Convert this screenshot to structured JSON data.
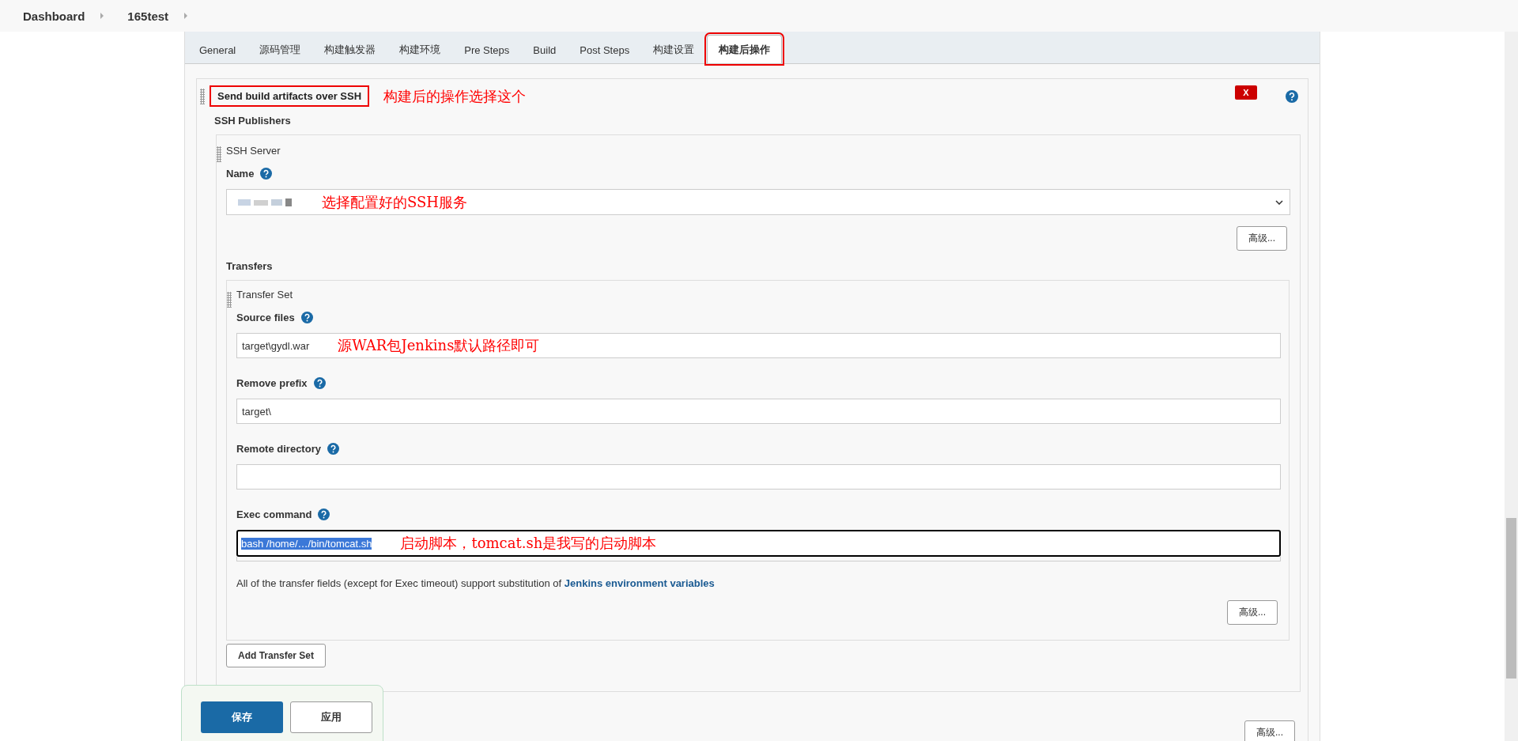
{
  "breadcrumbs": [
    {
      "label": "Dashboard"
    },
    {
      "label": "165test"
    }
  ],
  "tabs": [
    {
      "label": "General",
      "selected": false,
      "highlighted": false
    },
    {
      "label": "源码管理",
      "selected": false,
      "highlighted": false
    },
    {
      "label": "构建触发器",
      "selected": false,
      "highlighted": false
    },
    {
      "label": "构建环境",
      "selected": false,
      "highlighted": false
    },
    {
      "label": "Pre Steps",
      "selected": false,
      "highlighted": false
    },
    {
      "label": "Build",
      "selected": false,
      "highlighted": false
    },
    {
      "label": "Post Steps",
      "selected": false,
      "highlighted": false
    },
    {
      "label": "构建设置",
      "selected": false,
      "highlighted": false
    },
    {
      "label": "构建后操作",
      "selected": true,
      "highlighted": true
    }
  ],
  "section": {
    "title": "Send build artifacts over SSH",
    "highlighted": true,
    "annotation": "构建后的操作选择这个",
    "delete_label": "X",
    "publishers_label": "SSH Publishers",
    "server": {
      "title": "SSH Server",
      "name_label": "Name",
      "name_redacted": true,
      "name_annotation": "选择配置好的SSH服务",
      "advanced_label": "高级...",
      "transfers_label": "Transfers",
      "transfer_set": {
        "title": "Transfer Set",
        "fields": [
          {
            "label": "Source files",
            "value": "target\\gydl.war",
            "annotation": "源WAR包Jenkins默认路径即可",
            "kind": "input",
            "selected": false
          },
          {
            "label": "Remove prefix",
            "value": "target\\",
            "kind": "input",
            "selected": false
          },
          {
            "label": "Remote directory",
            "kind": "input",
            "selected": false
          },
          {
            "label": "Exec command",
            "value": "bash /home/…/bin/tomcat.sh",
            "annotation": "启动脚本，tomcat.sh是我写的启动脚本",
            "kind": "textarea",
            "selected": true
          }
        ],
        "note": "All of the transfer fields (except for Exec timeout) support substitution of",
        "note_link": "Jenkins environment variables",
        "advanced_label": "高级..."
      },
      "add_label": "Add Transfer Set"
    }
  },
  "footer": {
    "save_label": "保存",
    "apply_label": "应用",
    "advanced_label": "高级..."
  }
}
